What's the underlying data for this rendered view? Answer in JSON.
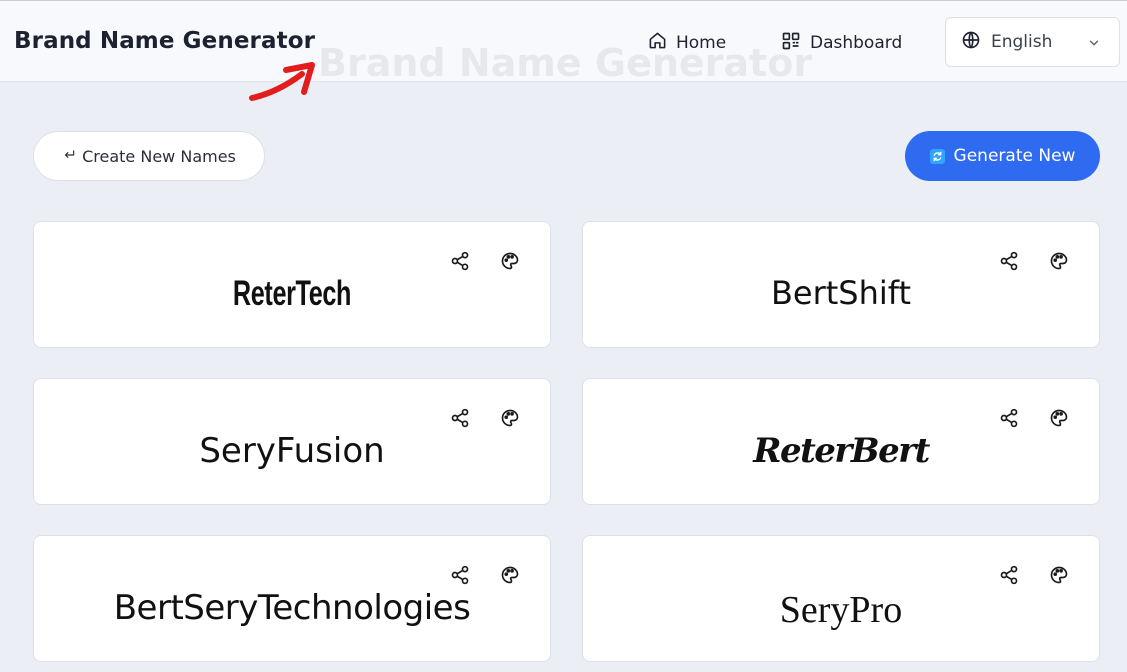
{
  "header": {
    "brand_title": "Brand Name Generator",
    "watermark_title": "Brand Name Generator",
    "nav": {
      "home_label": "Home",
      "dashboard_label": "Dashboard"
    },
    "language": {
      "selected": "English"
    }
  },
  "toolbar": {
    "create_label": "Create New Names",
    "generate_label": "Generate New"
  },
  "cards": [
    {
      "name": "ReterTech"
    },
    {
      "name": "BertShift"
    },
    {
      "name": "SeryFusion"
    },
    {
      "name": "ReterBert"
    },
    {
      "name": "BertSeryTechnologies"
    },
    {
      "name": "SeryPro"
    }
  ],
  "colors": {
    "accent": "#2f6bf0",
    "background": "#ebeef5",
    "annotation_arrow": "#e11d1d"
  },
  "icons": [
    "home-icon",
    "dashboard-icon",
    "globe-icon",
    "chevron-down-icon",
    "return-icon",
    "refresh-icon",
    "share-icon",
    "palette-icon"
  ]
}
